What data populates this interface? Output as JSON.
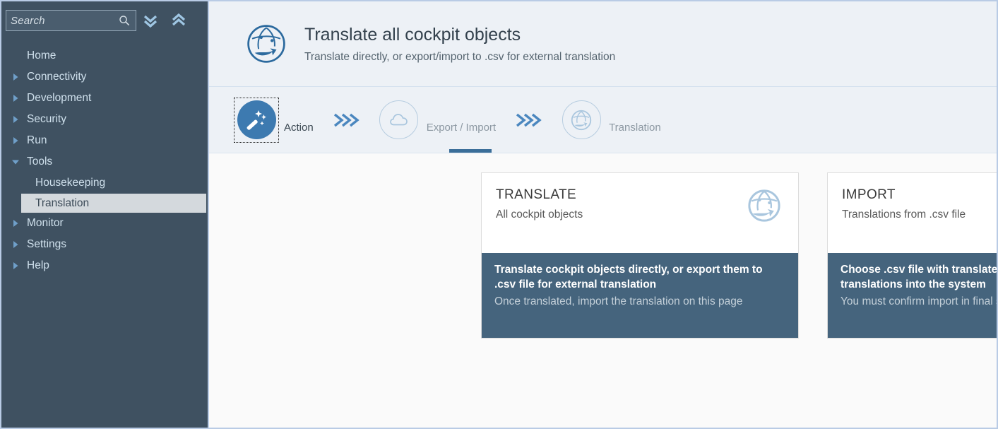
{
  "sidebar": {
    "search": {
      "placeholder": "Search",
      "icon": "search-icon"
    },
    "collapse_all_icon": "chevrons-down-icon",
    "expand_all_icon": "chevrons-up-icon",
    "items": [
      {
        "label": "Home",
        "expandable": false,
        "state": "none",
        "level": 0,
        "selected": false
      },
      {
        "label": "Connectivity",
        "expandable": true,
        "state": "collapsed",
        "level": 0,
        "selected": false
      },
      {
        "label": "Development",
        "expandable": true,
        "state": "collapsed",
        "level": 0,
        "selected": false
      },
      {
        "label": "Security",
        "expandable": true,
        "state": "collapsed",
        "level": 0,
        "selected": false
      },
      {
        "label": "Run",
        "expandable": true,
        "state": "collapsed",
        "level": 0,
        "selected": false
      },
      {
        "label": "Tools",
        "expandable": true,
        "state": "expanded",
        "level": 0,
        "selected": false
      },
      {
        "label": "Housekeeping",
        "expandable": false,
        "state": "none",
        "level": 1,
        "selected": false
      },
      {
        "label": "Translation",
        "expandable": false,
        "state": "none",
        "level": 1,
        "selected": true
      },
      {
        "label": "Monitor",
        "expandable": true,
        "state": "collapsed",
        "level": 0,
        "selected": false
      },
      {
        "label": "Settings",
        "expandable": true,
        "state": "collapsed",
        "level": 0,
        "selected": false
      },
      {
        "label": "Help",
        "expandable": true,
        "state": "collapsed",
        "level": 0,
        "selected": false
      }
    ]
  },
  "header": {
    "icon": "globe-translate-icon",
    "title": "Translate all cockpit objects",
    "subtitle": "Translate directly, or export/import to .csv for external translation"
  },
  "stepper": {
    "separator_icon": "triple-chevron-right-icon",
    "steps": [
      {
        "label": "Action",
        "icon": "magic-wand-icon",
        "active": true
      },
      {
        "label": "Export / Import",
        "icon": "cloud-icon",
        "active": false
      },
      {
        "label": "Translation",
        "icon": "globe-translate-icon",
        "active": false
      }
    ]
  },
  "cards": [
    {
      "title": "TRANSLATE",
      "subtitle": "All cockpit objects",
      "icon": "globe-translate-icon",
      "footer_main": "Translate cockpit objects directly, or export them to .csv file for external translation",
      "footer_sub": "Once translated, import the translation on this page"
    },
    {
      "title": "IMPORT",
      "subtitle": "Translations from .csv file",
      "icon": "cloud-upload-icon",
      "footer_main": "Choose .csv file with translated objects and import the translations into the system",
      "footer_sub": "You must confirm import in final step"
    }
  ],
  "colors": {
    "sidebar_bg": "#3f5161",
    "sidebar_text": "#cfe0ec",
    "selected_bg": "#d4d9dd",
    "header_bg": "#edf1f6",
    "accent_blue": "#3d7ab0",
    "card_footer_bg": "#45647d",
    "icon_blue": "#9fc2dd",
    "page_border": "#b9cbe5"
  }
}
